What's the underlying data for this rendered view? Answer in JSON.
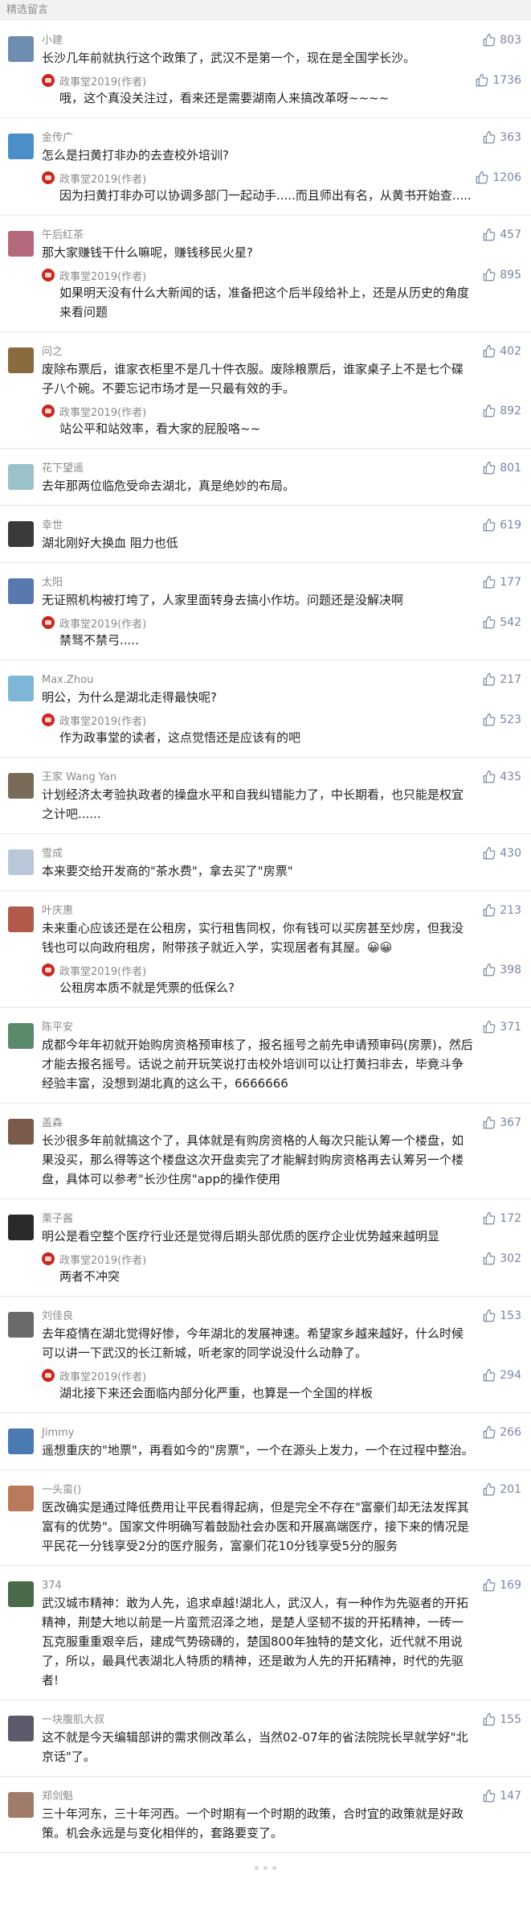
{
  "header": {
    "title": "精选留言"
  },
  "comments": [
    {
      "nickname": "小建",
      "likes": "803",
      "avatar_color": "#6f8db0",
      "content": "长沙几年前就执行这个政策了，武汉不是第一个，现在是全国学长沙。",
      "reply": {
        "author": "政事堂2019(作者)",
        "likes": "1736",
        "content": "哦，这个真没关注过，看来还是需要湖南人来搞改革呀~~~~"
      }
    },
    {
      "nickname": "金传广",
      "likes": "363",
      "avatar_color": "#4a8fc8",
      "content": "怎么是扫黄打非办的去查校外培训?",
      "reply": {
        "author": "政事堂2019(作者)",
        "likes": "1206",
        "content": "因为扫黄打非办可以协调多部门一起动手.....而且师出有名，从黄书开始查....."
      }
    },
    {
      "nickname": "午后红茶",
      "likes": "457",
      "avatar_color": "#b46a7c",
      "content": "那大家赚钱干什么嘛呢，赚钱移民火星?",
      "reply": {
        "author": "政事堂2019(作者)",
        "likes": "895",
        "content": "如果明天没有什么大新闻的话，准备把这个后半段给补上，还是从历史的角度来看问题"
      }
    },
    {
      "nickname": "问之",
      "likes": "402",
      "avatar_color": "#8a6a3e",
      "content": "废除布票后，谁家衣柜里不是几十件衣服。废除粮票后，谁家桌子上不是七个碟子八个碗。不要忘记市场才是一只最有效的手。",
      "reply": {
        "author": "政事堂2019(作者)",
        "likes": "892",
        "content": "站公平和站效率，看大家的屁股咯~~"
      }
    },
    {
      "nickname": "花下望遥",
      "likes": "801",
      "avatar_color": "#9ac2c8",
      "content": "去年那两位临危受命去湖北，真是绝妙的布局。"
    },
    {
      "nickname": "幸世",
      "likes": "619",
      "avatar_color": "#3a3a3a",
      "content": "湖北刚好大换血 阻力也低"
    },
    {
      "nickname": "太阳",
      "likes": "177",
      "avatar_color": "#5a78b0",
      "content": "无证照机构被打垮了，人家里面转身去搞小作坊。问题还是没解决啊",
      "reply": {
        "author": "政事堂2019(作者)",
        "likes": "542",
        "content": "禁驽不禁弓....."
      }
    },
    {
      "nickname": "Max.Zhou",
      "likes": "217",
      "avatar_color": "#7fb6d8",
      "content": "明公，为什么是湖北走得最快呢?",
      "reply": {
        "author": "政事堂2019(作者)",
        "likes": "523",
        "content": "作为政事堂的读者，这点觉悟还是应该有的吧"
      }
    },
    {
      "nickname": "王家 Wang Yan",
      "likes": "435",
      "avatar_color": "#7a6a5a",
      "content": "计划经济太考验执政者的操盘水平和自我纠错能力了，中长期看，也只能是权宜之计吧......"
    },
    {
      "nickname": "雪成",
      "likes": "430",
      "avatar_color": "#b8c8d8",
      "content": "本来要交给开发商的\"茶水费\"，拿去买了\"房票\""
    },
    {
      "nickname": "叶庆惠",
      "likes": "213",
      "avatar_color": "#b05a4a",
      "content": "未来重心应该还是在公租房，实行租售同权，你有钱可以买房甚至炒房，但我没钱也可以向政府租房，附带孩子就近入学，实现居者有其屋。😀😀",
      "reply": {
        "author": "政事堂2019(作者)",
        "likes": "398",
        "content": "公租房本质不就是凭票的低保么?"
      }
    },
    {
      "nickname": "陈平安",
      "likes": "371",
      "avatar_color": "#5a8a6a",
      "content": "成都今年年初就开始购房资格预审核了，报名摇号之前先申请预审码(房票)，然后才能去报名摇号。话说之前开玩笑说打击校外培训可以让打黄扫非去，毕竟斗争经验丰富，没想到湖北真的这么干，6666666"
    },
    {
      "nickname": "盖森",
      "likes": "367",
      "avatar_color": "#7a5a4a",
      "content": "长沙很多年前就搞这个了，具体就是有购房资格的人每次只能认筹一个楼盘，如果没买，那么得等这个楼盘这次开盘卖完了才能解封购房资格再去认筹另一个楼盘，具体可以参考\"长沙住房\"app的操作使用"
    },
    {
      "nickname": "栗子酱",
      "likes": "172",
      "avatar_color": "#2a2a2a",
      "content": "明公是看空整个医疗行业还是觉得后期头部优质的医疗企业优势越来越明显",
      "reply": {
        "author": "政事堂2019(作者)",
        "likes": "302",
        "content": "两者不冲突"
      }
    },
    {
      "nickname": "刘佳良",
      "likes": "153",
      "avatar_color": "#6a6a6a",
      "content": "去年疫情在湖北觉得好惨，今年湖北的发展神速。希望家乡越来越好，什么时候可以讲一下武汉的长江新城，听老家的同学说没什么动静了。",
      "reply": {
        "author": "政事堂2019(作者)",
        "likes": "294",
        "content": "湖北接下来还会面临内部分化严重，也算是一个全国的样板"
      }
    },
    {
      "nickname": "Jimmy",
      "likes": "266",
      "avatar_color": "#4a7ab0",
      "content": "遥想重庆的\"地票\"，再看如今的\"房票\"，一个在源头上发力，一个在过程中整治。"
    },
    {
      "nickname": "一头蛮()",
      "likes": "201",
      "avatar_color": "#b87a5a",
      "content": "医改确实是通过降低费用让平民看得起病，但是完全不存在\"富豪们却无法发挥其富有的优势\"。国家文件明确写着鼓励社会办医和开展高端医疗，接下来的情况是平民花一分钱享受2分的医疗服务，富豪们花10分钱享受5分的服务"
    },
    {
      "nickname": "374",
      "likes": "169",
      "avatar_color": "#4a6a4a",
      "content": "武汉城市精神：敢为人先，追求卓越!湖北人，武汉人，有一种作为先驱者的开拓精神，荆楚大地以前是一片蛮荒沼泽之地，是楚人坚韧不拔的开拓精神，一砖一瓦克服重重艰辛后，建成气势磅礴的，楚国800年独特的楚文化，近代就不用说了，所以，最具代表湖北人特质的精神，还是敢为人先的开拓精神，时代的先驱者!"
    },
    {
      "nickname": "一块腹肌大叔",
      "likes": "155",
      "avatar_color": "#5a5a6a",
      "content": "这不就是今天编辑部讲的需求侧改革么，当然02-07年的省法院院长早就学好\"北京话\"了。"
    },
    {
      "nickname": "郑剑魁",
      "likes": "147",
      "avatar_color": "#a07a6a",
      "content": "三十年河东，三十年河西。一个时期有一个时期的政策，合时宜的政策就是好政策。机会永远是与变化相伴的，套路要变了。"
    }
  ],
  "icons": {
    "like": "thumb-up-icon",
    "author": "author-badge-icon"
  },
  "colors": {
    "like": "#7a86a4",
    "author_badge": "#c8281e"
  }
}
